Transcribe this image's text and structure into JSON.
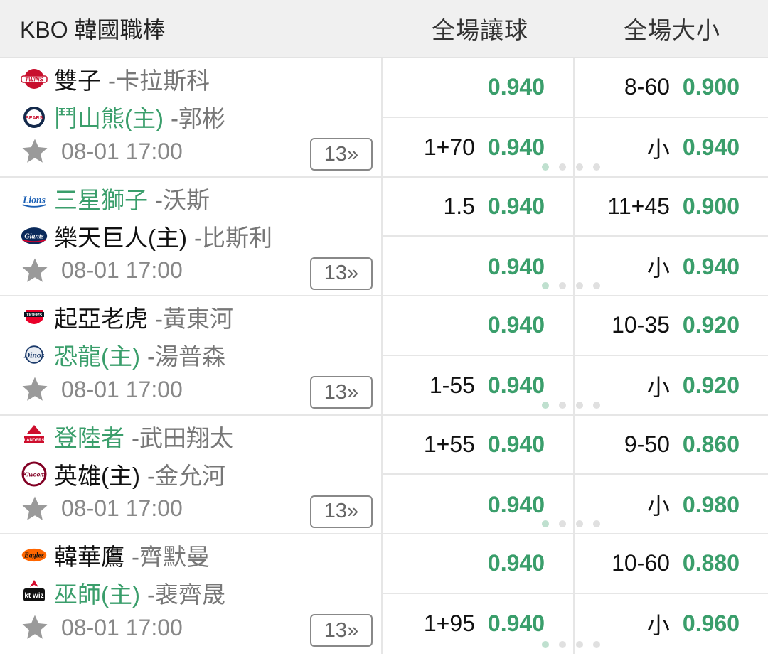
{
  "header": {
    "league": "KBO 韓國職棒",
    "handicap_title": "全場讓球",
    "overunder_title": "全場大小"
  },
  "matches": [
    {
      "team1": {
        "name": "雙子",
        "pitcher": "-卡拉斯科",
        "highlight": false,
        "logo": "twins-logo"
      },
      "team2": {
        "name": "鬥山熊(主)",
        "pitcher": "-郭彬",
        "highlight": true,
        "logo": "bears-logo"
      },
      "time": "08-01 17:00",
      "more": "13»",
      "handicap": [
        {
          "line": "",
          "odd": "0.940"
        },
        {
          "line": "1+70",
          "odd": "0.940"
        }
      ],
      "overunder": [
        {
          "line": "8-60",
          "odd": "0.900"
        },
        {
          "line": "小",
          "odd": "0.940"
        }
      ]
    },
    {
      "team1": {
        "name": "三星獅子",
        "pitcher": "-沃斯",
        "highlight": true,
        "logo": "lions-logo"
      },
      "team2": {
        "name": "樂天巨人(主)",
        "pitcher": "-比斯利",
        "highlight": false,
        "logo": "giants-logo"
      },
      "time": "08-01 17:00",
      "more": "13»",
      "handicap": [
        {
          "line": "1.5",
          "odd": "0.940"
        },
        {
          "line": "",
          "odd": "0.940"
        }
      ],
      "overunder": [
        {
          "line": "11+45",
          "odd": "0.900"
        },
        {
          "line": "小",
          "odd": "0.940"
        }
      ]
    },
    {
      "team1": {
        "name": "起亞老虎",
        "pitcher": "-黃東河",
        "highlight": false,
        "logo": "tigers-logo"
      },
      "team2": {
        "name": "恐龍(主)",
        "pitcher": "-湯普森",
        "highlight": true,
        "logo": "dinos-logo"
      },
      "time": "08-01 17:00",
      "more": "13»",
      "handicap": [
        {
          "line": "",
          "odd": "0.940"
        },
        {
          "line": "1-55",
          "odd": "0.940"
        }
      ],
      "overunder": [
        {
          "line": "10-35",
          "odd": "0.920"
        },
        {
          "line": "小",
          "odd": "0.920"
        }
      ]
    },
    {
      "team1": {
        "name": "登陸者",
        "pitcher": "-武田翔太",
        "highlight": true,
        "logo": "landers-logo"
      },
      "team2": {
        "name": "英雄(主)",
        "pitcher": "-金允河",
        "highlight": false,
        "logo": "kiwoom-logo"
      },
      "time": "08-01 17:00",
      "more": "13»",
      "handicap": [
        {
          "line": "1+55",
          "odd": "0.940"
        },
        {
          "line": "",
          "odd": "0.940"
        }
      ],
      "overunder": [
        {
          "line": "9-50",
          "odd": "0.860"
        },
        {
          "line": "小",
          "odd": "0.980"
        }
      ]
    },
    {
      "team1": {
        "name": "韓華鷹",
        "pitcher": "-齊默曼",
        "highlight": false,
        "logo": "eagles-logo"
      },
      "team2": {
        "name": "巫師(主)",
        "pitcher": "-裵齊晟",
        "highlight": true,
        "logo": "ktwiz-logo"
      },
      "time": "08-01 17:00",
      "more": "13»",
      "handicap": [
        {
          "line": "",
          "odd": "0.940"
        },
        {
          "line": "1+95",
          "odd": "0.940"
        }
      ],
      "overunder": [
        {
          "line": "10-60",
          "odd": "0.880"
        },
        {
          "line": "小",
          "odd": "0.960"
        }
      ]
    }
  ],
  "colors": {
    "accent_green": "#3a9e6b",
    "header_bg": "#f0f0f0",
    "muted_text": "#777777"
  },
  "icons": {
    "favorite": "star-icon",
    "carousel": "pagination-dots"
  }
}
